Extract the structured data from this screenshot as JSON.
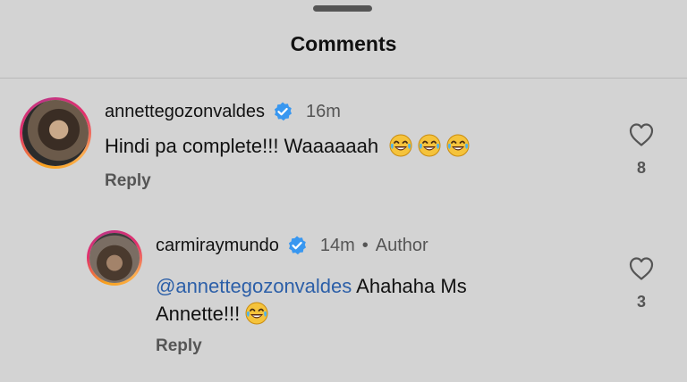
{
  "sheet": {
    "title": "Comments"
  },
  "comments": [
    {
      "username": "annettegozonvaldes",
      "verified": true,
      "time": "16m",
      "text": "Hindi pa complete!!! Waaaaaah",
      "emojis": [
        "tears-of-joy",
        "tears-of-joy",
        "tears-of-joy"
      ],
      "reply_label": "Reply",
      "likes": "8"
    },
    {
      "username": "carmiraymundo",
      "verified": true,
      "time": "14m",
      "separator": "•",
      "badge": "Author",
      "mention": "@annettegozonvaldes",
      "text": " Ahahaha Ms Annette!!!",
      "emojis": [
        "tears-of-joy"
      ],
      "reply_label": "Reply",
      "likes": "3"
    }
  ],
  "colors": {
    "background": "#d3d3d3",
    "mention": "#2c5fa8",
    "verified": "#3897f0"
  },
  "icons": {
    "verified": "verified-badge-icon",
    "like": "heart-outline-icon"
  }
}
